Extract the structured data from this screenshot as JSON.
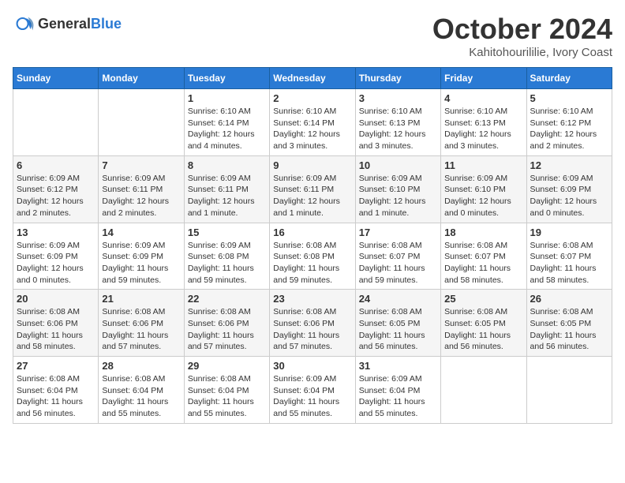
{
  "logo": {
    "general": "General",
    "blue": "Blue"
  },
  "header": {
    "month": "October 2024",
    "location": "Kahitohourililie, Ivory Coast"
  },
  "weekdays": [
    "Sunday",
    "Monday",
    "Tuesday",
    "Wednesday",
    "Thursday",
    "Friday",
    "Saturday"
  ],
  "weeks": [
    [
      {
        "day": "",
        "info": ""
      },
      {
        "day": "",
        "info": ""
      },
      {
        "day": "1",
        "info": "Sunrise: 6:10 AM\nSunset: 6:14 PM\nDaylight: 12 hours and 4 minutes."
      },
      {
        "day": "2",
        "info": "Sunrise: 6:10 AM\nSunset: 6:14 PM\nDaylight: 12 hours and 3 minutes."
      },
      {
        "day": "3",
        "info": "Sunrise: 6:10 AM\nSunset: 6:13 PM\nDaylight: 12 hours and 3 minutes."
      },
      {
        "day": "4",
        "info": "Sunrise: 6:10 AM\nSunset: 6:13 PM\nDaylight: 12 hours and 3 minutes."
      },
      {
        "day": "5",
        "info": "Sunrise: 6:10 AM\nSunset: 6:12 PM\nDaylight: 12 hours and 2 minutes."
      }
    ],
    [
      {
        "day": "6",
        "info": "Sunrise: 6:09 AM\nSunset: 6:12 PM\nDaylight: 12 hours and 2 minutes."
      },
      {
        "day": "7",
        "info": "Sunrise: 6:09 AM\nSunset: 6:11 PM\nDaylight: 12 hours and 2 minutes."
      },
      {
        "day": "8",
        "info": "Sunrise: 6:09 AM\nSunset: 6:11 PM\nDaylight: 12 hours and 1 minute."
      },
      {
        "day": "9",
        "info": "Sunrise: 6:09 AM\nSunset: 6:11 PM\nDaylight: 12 hours and 1 minute."
      },
      {
        "day": "10",
        "info": "Sunrise: 6:09 AM\nSunset: 6:10 PM\nDaylight: 12 hours and 1 minute."
      },
      {
        "day": "11",
        "info": "Sunrise: 6:09 AM\nSunset: 6:10 PM\nDaylight: 12 hours and 0 minutes."
      },
      {
        "day": "12",
        "info": "Sunrise: 6:09 AM\nSunset: 6:09 PM\nDaylight: 12 hours and 0 minutes."
      }
    ],
    [
      {
        "day": "13",
        "info": "Sunrise: 6:09 AM\nSunset: 6:09 PM\nDaylight: 12 hours and 0 minutes."
      },
      {
        "day": "14",
        "info": "Sunrise: 6:09 AM\nSunset: 6:09 PM\nDaylight: 11 hours and 59 minutes."
      },
      {
        "day": "15",
        "info": "Sunrise: 6:09 AM\nSunset: 6:08 PM\nDaylight: 11 hours and 59 minutes."
      },
      {
        "day": "16",
        "info": "Sunrise: 6:08 AM\nSunset: 6:08 PM\nDaylight: 11 hours and 59 minutes."
      },
      {
        "day": "17",
        "info": "Sunrise: 6:08 AM\nSunset: 6:07 PM\nDaylight: 11 hours and 59 minutes."
      },
      {
        "day": "18",
        "info": "Sunrise: 6:08 AM\nSunset: 6:07 PM\nDaylight: 11 hours and 58 minutes."
      },
      {
        "day": "19",
        "info": "Sunrise: 6:08 AM\nSunset: 6:07 PM\nDaylight: 11 hours and 58 minutes."
      }
    ],
    [
      {
        "day": "20",
        "info": "Sunrise: 6:08 AM\nSunset: 6:06 PM\nDaylight: 11 hours and 58 minutes."
      },
      {
        "day": "21",
        "info": "Sunrise: 6:08 AM\nSunset: 6:06 PM\nDaylight: 11 hours and 57 minutes."
      },
      {
        "day": "22",
        "info": "Sunrise: 6:08 AM\nSunset: 6:06 PM\nDaylight: 11 hours and 57 minutes."
      },
      {
        "day": "23",
        "info": "Sunrise: 6:08 AM\nSunset: 6:06 PM\nDaylight: 11 hours and 57 minutes."
      },
      {
        "day": "24",
        "info": "Sunrise: 6:08 AM\nSunset: 6:05 PM\nDaylight: 11 hours and 56 minutes."
      },
      {
        "day": "25",
        "info": "Sunrise: 6:08 AM\nSunset: 6:05 PM\nDaylight: 11 hours and 56 minutes."
      },
      {
        "day": "26",
        "info": "Sunrise: 6:08 AM\nSunset: 6:05 PM\nDaylight: 11 hours and 56 minutes."
      }
    ],
    [
      {
        "day": "27",
        "info": "Sunrise: 6:08 AM\nSunset: 6:04 PM\nDaylight: 11 hours and 56 minutes."
      },
      {
        "day": "28",
        "info": "Sunrise: 6:08 AM\nSunset: 6:04 PM\nDaylight: 11 hours and 55 minutes."
      },
      {
        "day": "29",
        "info": "Sunrise: 6:08 AM\nSunset: 6:04 PM\nDaylight: 11 hours and 55 minutes."
      },
      {
        "day": "30",
        "info": "Sunrise: 6:09 AM\nSunset: 6:04 PM\nDaylight: 11 hours and 55 minutes."
      },
      {
        "day": "31",
        "info": "Sunrise: 6:09 AM\nSunset: 6:04 PM\nDaylight: 11 hours and 55 minutes."
      },
      {
        "day": "",
        "info": ""
      },
      {
        "day": "",
        "info": ""
      }
    ]
  ]
}
